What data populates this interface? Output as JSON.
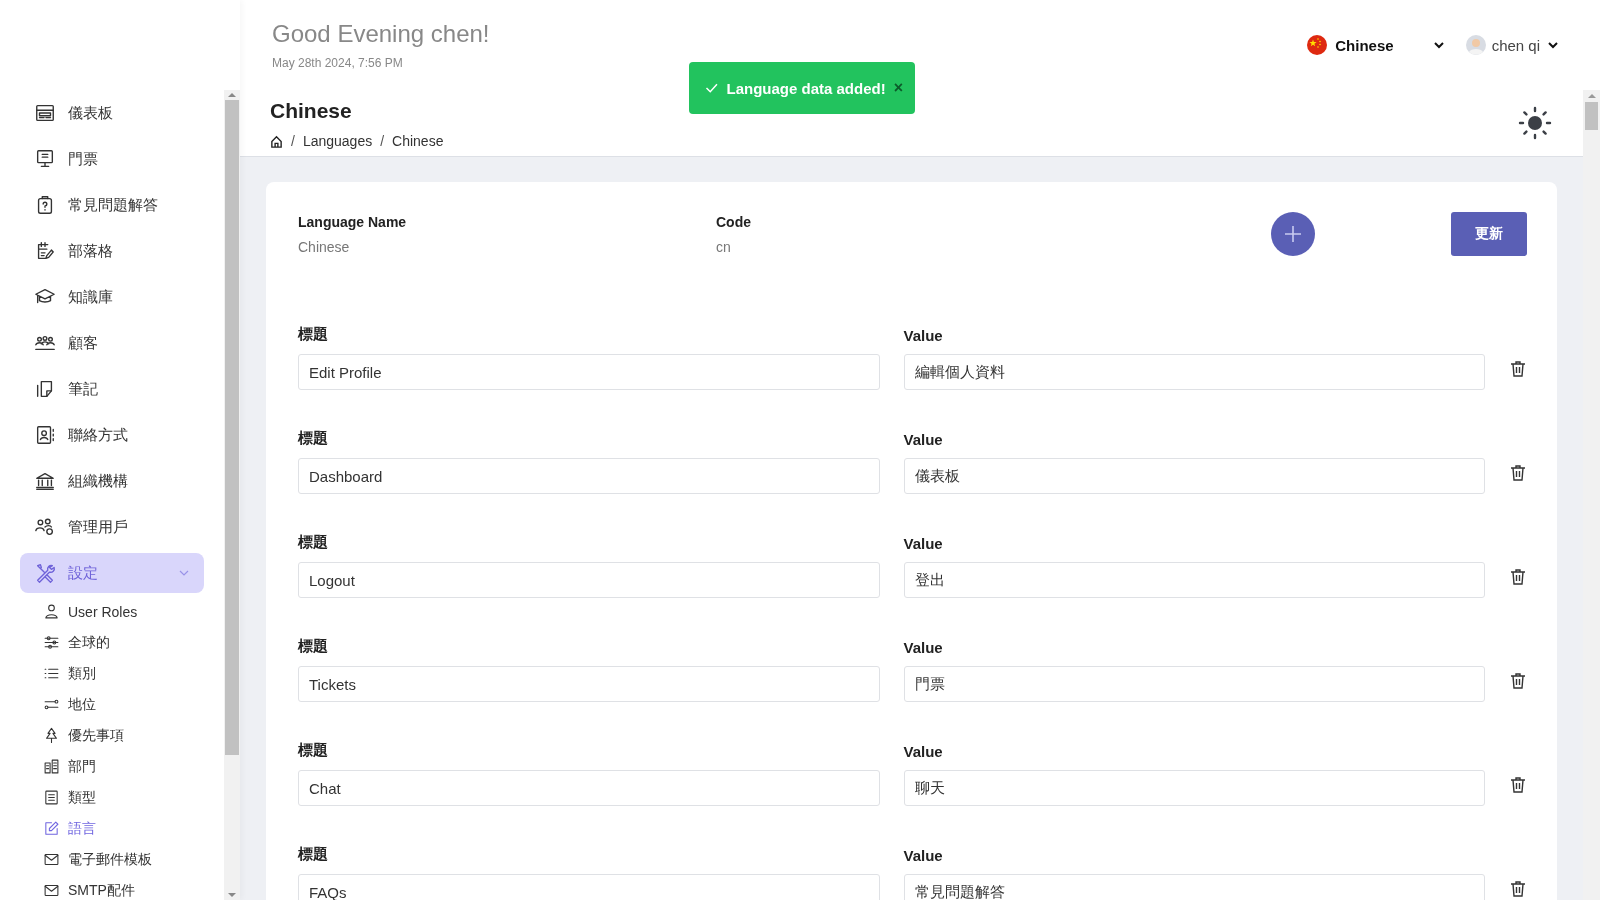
{
  "header": {
    "greeting": "Good Evening chen!",
    "datetime": "May 28th 2024, 7:56 PM",
    "language": "Chinese",
    "user": "chen qi"
  },
  "toast": {
    "message": "Language data added!",
    "close": "×"
  },
  "sidebar": {
    "items": [
      {
        "label": "儀表板",
        "kind": "layout",
        "selected": false
      },
      {
        "label": "門票",
        "kind": "monitor",
        "selected": false
      },
      {
        "label": "常見問題解答",
        "kind": "clipboard",
        "selected": false
      },
      {
        "label": "部落格",
        "kind": "notepad",
        "selected": false
      },
      {
        "label": "知識庫",
        "kind": "cap",
        "selected": false
      },
      {
        "label": "顧客",
        "kind": "people",
        "selected": false
      },
      {
        "label": "筆記",
        "kind": "note",
        "selected": false
      },
      {
        "label": "聯絡方式",
        "kind": "contact",
        "selected": false
      },
      {
        "label": "組織機構",
        "kind": "bank",
        "selected": false
      },
      {
        "label": "管理用戶",
        "kind": "usergear",
        "selected": false
      },
      {
        "label": "設定",
        "kind": "tools",
        "selected": true,
        "expanded": true,
        "children": [
          {
            "label": "User Roles",
            "kind": "user",
            "selected": false
          },
          {
            "label": "全球的",
            "kind": "sliders",
            "selected": false
          },
          {
            "label": "類別",
            "kind": "list",
            "selected": false
          },
          {
            "label": "地位",
            "kind": "toggle",
            "selected": false
          },
          {
            "label": "優先事項",
            "kind": "tree",
            "selected": false
          },
          {
            "label": "部門",
            "kind": "building",
            "selected": false
          },
          {
            "label": "類型",
            "kind": "checklist",
            "selected": false
          },
          {
            "label": "語言",
            "kind": "edit",
            "selected": true
          },
          {
            "label": "電子郵件模板",
            "kind": "mail",
            "selected": false
          },
          {
            "label": "SMTP配件",
            "kind": "mail",
            "selected": false
          }
        ]
      }
    ]
  },
  "page": {
    "title": "Chinese",
    "breadcrumb": [
      {
        "separator": "/",
        "label": "Languages"
      },
      {
        "separator": "/",
        "label": "Chinese"
      }
    ]
  },
  "card": {
    "name_label": "Language Name",
    "name": "Chinese",
    "code_label": "Code",
    "code": "cn",
    "update_button": "更新",
    "rows": [
      {
        "key_label": "標題",
        "key": "Edit Profile",
        "value_label": "Value",
        "value": "編輯個人資料"
      },
      {
        "key_label": "標題",
        "key": "Dashboard",
        "value_label": "Value",
        "value": "儀表板"
      },
      {
        "key_label": "標題",
        "key": "Logout",
        "value_label": "Value",
        "value": "登出"
      },
      {
        "key_label": "標題",
        "key": "Tickets",
        "value_label": "Value",
        "value": "門票"
      },
      {
        "key_label": "標題",
        "key": "Chat",
        "value_label": "Value",
        "value": "聊天"
      },
      {
        "key_label": "標題",
        "key": "FAQs",
        "value_label": "Value",
        "value": "常見問題解答"
      }
    ]
  }
}
